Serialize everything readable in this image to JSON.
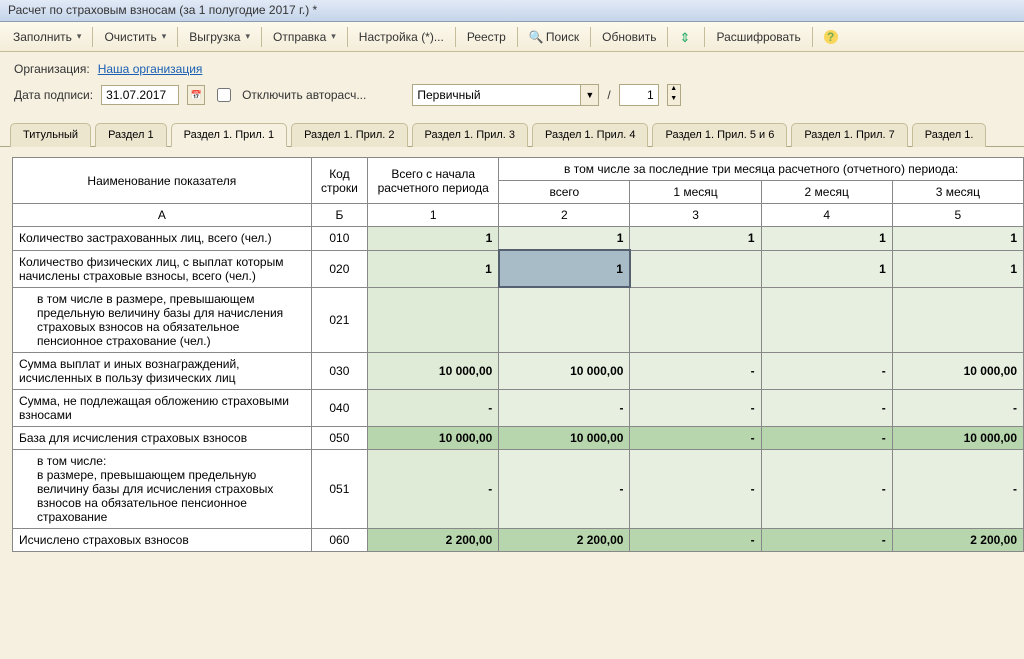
{
  "window": {
    "title": "Расчет по страховым взносам (за 1 полугодие 2017 г.) *"
  },
  "toolbar": {
    "fill": "Заполнить",
    "clear": "Очистить",
    "export": "Выгрузка",
    "send": "Отправка",
    "settings": "Настройка (*)...",
    "registry": "Реестр",
    "search": "Поиск",
    "refresh": "Обновить",
    "decode": "Расшифровать"
  },
  "form": {
    "org_label": "Организация:",
    "org_value": "Наша организация",
    "sign_date_label": "Дата подписи:",
    "sign_date": "31.07.2017",
    "disable_auto": "Отключить авторасч...",
    "doc_type": "Первичный",
    "slash": "/",
    "seq": "1"
  },
  "tabs": [
    "Титульный",
    "Раздел 1",
    "Раздел 1. Прил. 1",
    "Раздел 1. Прил. 2",
    "Раздел 1. Прил. 3",
    "Раздел 1. Прил. 4",
    "Раздел 1. Прил. 5 и 6",
    "Раздел 1. Прил. 7",
    "Раздел 1."
  ],
  "table": {
    "headers": {
      "name": "Наименование показателя",
      "code": "Код строки",
      "total": "Всего с начала расчетного периода",
      "group": "в том числе за последние три месяца расчетного (отчетного) периода:",
      "sub": [
        "всего",
        "1 месяц",
        "2 месяц",
        "3 месяц"
      ],
      "letters": [
        "А",
        "Б",
        "1",
        "2",
        "3",
        "4",
        "5"
      ]
    },
    "rows": [
      {
        "name": "Количество застрахованных лиц, всего (чел.)",
        "code": "010",
        "v": [
          "1",
          "1",
          "1",
          "1",
          "1"
        ],
        "indent": false
      },
      {
        "name": "Количество физических лиц, с выплат которым начислены страховые взносы, всего (чел.)",
        "code": "020",
        "v": [
          "1",
          "1",
          "",
          "1",
          "1"
        ],
        "indent": false,
        "selected_col": 1
      },
      {
        "name": "в том числе в размере, превышающем предельную величину базы для начисления страховых взносов на обязательное пенсионное страхование (чел.)",
        "code": "021",
        "v": [
          "",
          "",
          "",
          "",
          ""
        ],
        "indent": true
      },
      {
        "name": "Сумма выплат и иных вознаграждений, исчисленных в пользу физических лиц",
        "code": "030",
        "v": [
          "10 000,00",
          "10 000,00",
          "-",
          "-",
          "10 000,00"
        ],
        "indent": false
      },
      {
        "name": "Сумма, не подлежащая обложению страховыми взносами",
        "code": "040",
        "v": [
          "-",
          "-",
          "-",
          "-",
          "-"
        ],
        "indent": false
      },
      {
        "name": "База для исчисления страховых взносов",
        "code": "050",
        "v": [
          "10 000,00",
          "10 000,00",
          "-",
          "-",
          "10 000,00"
        ],
        "indent": false,
        "hl": true
      },
      {
        "name": "в том числе:\nв размере, превышающем предельную величину базы для исчисления страховых взносов на обязательное пенсионное страхование",
        "code": "051",
        "v": [
          "-",
          "-",
          "-",
          "-",
          "-"
        ],
        "indent": true
      },
      {
        "name": "Исчислено страховых взносов",
        "code": "060",
        "v": [
          "2 200,00",
          "2 200,00",
          "-",
          "-",
          "2 200,00"
        ],
        "indent": false,
        "hl": true
      }
    ]
  }
}
